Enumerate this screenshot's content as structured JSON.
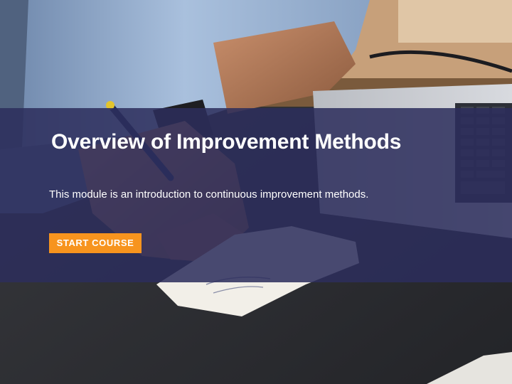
{
  "hero": {
    "title": "Overview of Improvement Methods",
    "description": "This module is an introduction to continuous improvement methods.",
    "start_label": "START COURSE"
  },
  "colors": {
    "overlay": "#2c2d5c",
    "button": "#f7941e",
    "text": "#ffffff"
  }
}
